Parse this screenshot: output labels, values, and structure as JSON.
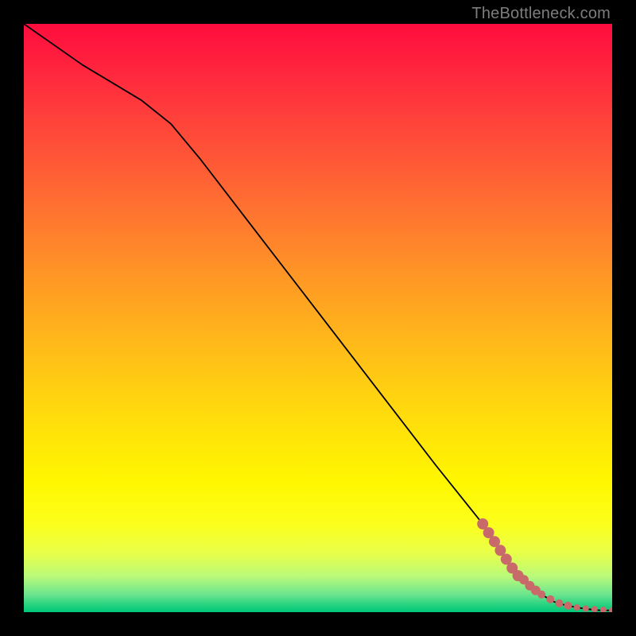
{
  "watermark": "TheBottleneck.com",
  "colors": {
    "marker": "#c96a6a",
    "curve": "#000000"
  },
  "chart_data": {
    "type": "line",
    "title": "",
    "xlabel": "",
    "ylabel": "",
    "xlim": [
      0,
      100
    ],
    "ylim": [
      0,
      100
    ],
    "grid": false,
    "series": [
      {
        "name": "bottleneck-curve",
        "x": [
          0,
          10,
          20,
          25,
          30,
          40,
          50,
          60,
          70,
          78,
          80,
          82,
          85,
          88,
          90,
          92,
          94,
          96,
          98,
          100
        ],
        "y": [
          100,
          93,
          87,
          83,
          77,
          64,
          51,
          38,
          25,
          15,
          12,
          9,
          5.5,
          3,
          1.8,
          1.2,
          0.8,
          0.5,
          0.3,
          0.3
        ]
      }
    ],
    "markers": [
      {
        "x": 78,
        "y": 15,
        "size": 7
      },
      {
        "x": 79,
        "y": 13.5,
        "size": 7
      },
      {
        "x": 80,
        "y": 12,
        "size": 7
      },
      {
        "x": 81,
        "y": 10.5,
        "size": 7
      },
      {
        "x": 82,
        "y": 9,
        "size": 7
      },
      {
        "x": 83,
        "y": 7.5,
        "size": 7
      },
      {
        "x": 84,
        "y": 6.2,
        "size": 7
      },
      {
        "x": 85,
        "y": 5.5,
        "size": 6
      },
      {
        "x": 86,
        "y": 4.5,
        "size": 6
      },
      {
        "x": 87,
        "y": 3.7,
        "size": 6
      },
      {
        "x": 88,
        "y": 3,
        "size": 5
      },
      {
        "x": 89.5,
        "y": 2.2,
        "size": 5
      },
      {
        "x": 91,
        "y": 1.5,
        "size": 5
      },
      {
        "x": 92.5,
        "y": 1.1,
        "size": 5
      },
      {
        "x": 94,
        "y": 0.8,
        "size": 4
      },
      {
        "x": 95.5,
        "y": 0.6,
        "size": 4
      },
      {
        "x": 97,
        "y": 0.5,
        "size": 4
      },
      {
        "x": 98.5,
        "y": 0.4,
        "size": 4
      },
      {
        "x": 100,
        "y": 0.3,
        "size": 4
      }
    ]
  }
}
